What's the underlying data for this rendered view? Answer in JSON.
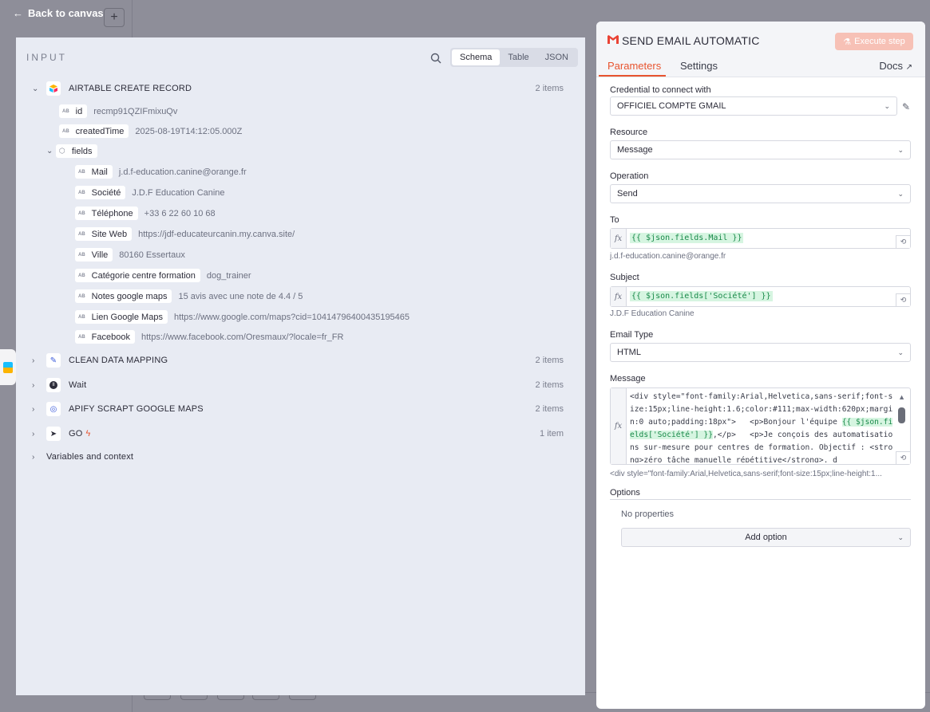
{
  "topbar": {
    "back_label": "Back to canvas"
  },
  "input_panel": {
    "title": "INPUT",
    "view_tabs": [
      "Schema",
      "Table",
      "JSON"
    ],
    "active_view": "Schema",
    "nodes": [
      {
        "title": "AIRTABLE CREATE RECORD",
        "count": "2 items",
        "fields": [
          {
            "key": "id",
            "value": "recmp91QZIFmixuQv"
          },
          {
            "key": "createdTime",
            "value": "2025-08-19T14:12:05.000Z"
          }
        ],
        "group": {
          "key": "fields",
          "fields": [
            {
              "key": "Mail",
              "value": "j.d.f-education.canine@orange.fr"
            },
            {
              "key": "Société",
              "value": "J.D.F Education Canine"
            },
            {
              "key": "Téléphone",
              "value": "+33 6 22 60 10 68"
            },
            {
              "key": "Site Web",
              "value": "https://jdf-educateurcanin.my.canva.site/"
            },
            {
              "key": "Ville",
              "value": "80160 Essertaux"
            },
            {
              "key": "Catégorie centre formation",
              "value": "dog_trainer"
            },
            {
              "key": "Notes google maps",
              "value": "15 avis avec une note de 4.4 / 5"
            },
            {
              "key": "Lien Google Maps",
              "value": "https://www.google.com/maps?cid=10414796400435195465"
            },
            {
              "key": "Facebook",
              "value": "https://www.facebook.com/Oresmaux/?locale=fr_FR"
            }
          ]
        }
      },
      {
        "title": "CLEAN DATA MAPPING",
        "count": "2 items"
      },
      {
        "title": "Wait",
        "count": "2 items"
      },
      {
        "title": "APIFY SCRAPT GOOGLE MAPS",
        "count": "2 items"
      },
      {
        "title": "GO",
        "count": "1 item"
      }
    ],
    "variables_label": "Variables and context"
  },
  "node_panel": {
    "title": "SEND EMAIL AUTOMATIC",
    "execute_label": "Execute step",
    "tabs": [
      "Parameters",
      "Settings"
    ],
    "docs_label": "Docs",
    "credential": {
      "label": "Credential to connect with",
      "value": "OFFICIEL COMPTE GMAIL"
    },
    "resource": {
      "label": "Resource",
      "value": "Message"
    },
    "operation": {
      "label": "Operation",
      "value": "Send"
    },
    "to": {
      "label": "To",
      "expression": "{{ $json.fields.Mail }}",
      "preview": "j.d.f-education.canine@orange.fr"
    },
    "subject": {
      "label": "Subject",
      "expression": "{{ $json.fields['Société'] }}",
      "preview": "J.D.F Education Canine"
    },
    "email_type": {
      "label": "Email Type",
      "value": "HTML"
    },
    "message": {
      "label": "Message",
      "code_before": "<div style=\"font-family:Arial,Helvetica,sans-serif;font-size:15px;line-height:1.6;color:#111;max-width:620px;margin:0 auto;padding:18px\">   <p>Bonjour l'équipe ",
      "code_expr": "{{ $json.fields['Société'] }}",
      "code_after": ",</p>   <p>Je conçois des automatisations sur-mesure pour centres de formation. Objectif : <strong>zéro tâche manuelle répétitive</strong>, d",
      "preview": "<div style=\"font-family:Arial,Helvetica,sans-serif;font-size:15px;line-height:1..."
    },
    "options": {
      "label": "Options",
      "empty_text": "No properties",
      "add_label": "Add option"
    }
  }
}
